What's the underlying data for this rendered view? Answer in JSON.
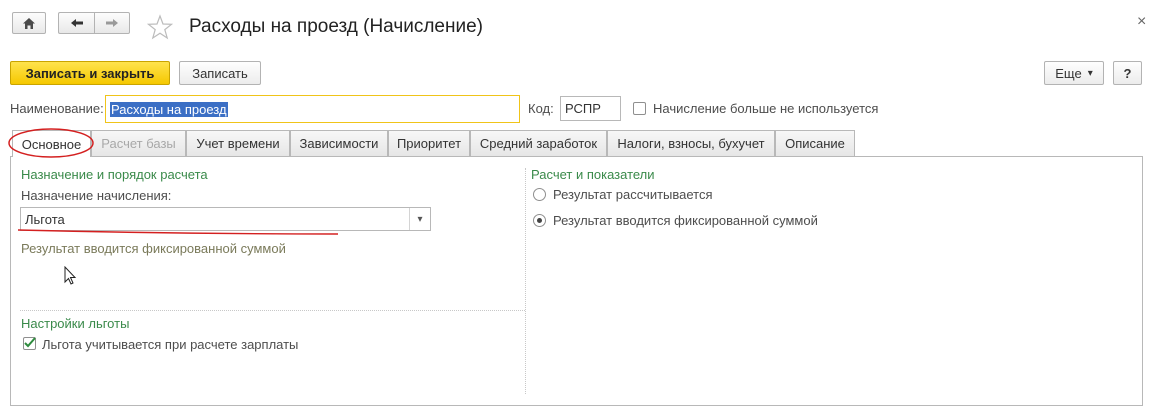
{
  "window": {
    "title": "Расходы на проезд (Начисление)",
    "close_glyph": "×",
    "home_glyph": "⌂",
    "back_glyph": "←",
    "forward_glyph": "→",
    "star_glyph": "☆"
  },
  "toolbar": {
    "save_close_label": "Записать и закрыть",
    "save_label": "Записать",
    "more_label": "Еще",
    "more_arrow": "▾",
    "help_label": "?"
  },
  "header": {
    "name_label": "Наименование:",
    "name_value": "Расходы на проезд",
    "code_label": "Код:",
    "code_value": "РСПР",
    "unused_label": "Начисление больше не используется"
  },
  "tabs": [
    {
      "label": "Основное"
    },
    {
      "label": "Расчет базы"
    },
    {
      "label": "Учет времени"
    },
    {
      "label": "Зависимости"
    },
    {
      "label": "Приоритет"
    },
    {
      "label": "Средний заработок"
    },
    {
      "label": "Налоги, взносы, бухучет"
    },
    {
      "label": "Описание"
    }
  ],
  "left_panel": {
    "section_title": "Назначение и порядок расчета",
    "purpose_label": "Назначение начисления:",
    "purpose_value": "Льгота",
    "purpose_arrow": "▾",
    "hint": "Результат вводится фиксированной суммой",
    "benefit_title": "Настройки льготы",
    "benefit_checkbox_label": "Льгота учитывается при расчете зарплаты"
  },
  "right_panel": {
    "section_title": "Расчет и показатели",
    "radio_calculated": "Результат рассчитывается",
    "radio_fixed": "Результат вводится фиксированной суммой"
  },
  "colors": {
    "accent_yellow": "#f5c800",
    "section_green": "#3a8a4a",
    "annotation_red": "#d42020",
    "selection_blue": "#3b6fc5"
  }
}
